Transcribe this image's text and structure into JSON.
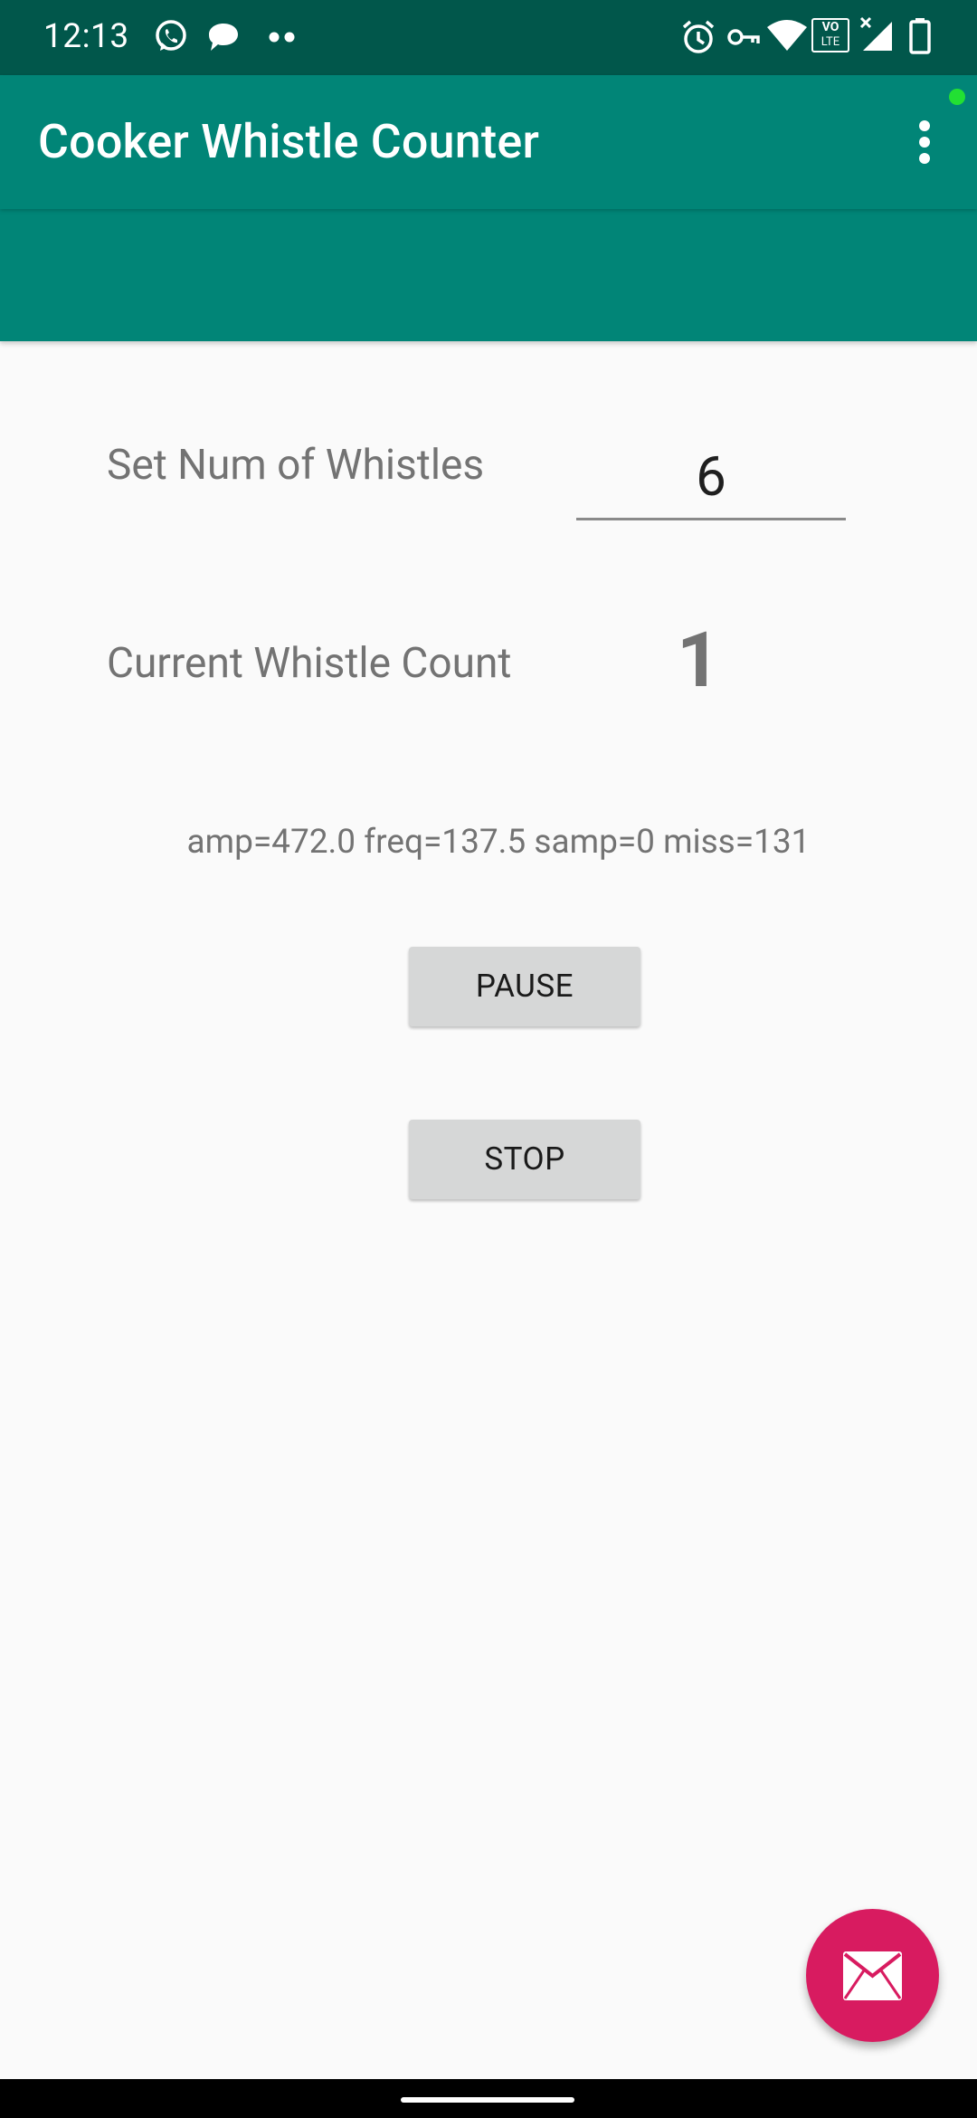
{
  "status_bar": {
    "time": "12:13",
    "left_icons": [
      "whatsapp-icon",
      "message-bubble-icon",
      "more-notifications-icon"
    ],
    "right_icons": [
      "alarm-icon",
      "vpn-key-icon",
      "wifi-icon",
      "volte-icon",
      "signal-icon",
      "battery-icon"
    ],
    "volte_label_top": "VO",
    "volte_label_bottom": "LTE"
  },
  "app_bar": {
    "title": "Cooker Whistle Counter",
    "menu_icon": "overflow-menu-icon"
  },
  "main": {
    "set_label": "Set Num of Whistles",
    "set_value": "6",
    "count_label": "Current Whistle Count",
    "count_value": "1",
    "debug_text": "amp=472.0 freq=137.5 samp=0 miss=131",
    "pause_label": "PAUSE",
    "stop_label": "STOP"
  },
  "fab": {
    "icon": "email-icon"
  },
  "colors": {
    "status_bar": "#01574b",
    "primary": "#018577",
    "accent": "#d81b60",
    "background": "#fafafa",
    "button": "#d6d7d7",
    "text_secondary": "#737373"
  }
}
